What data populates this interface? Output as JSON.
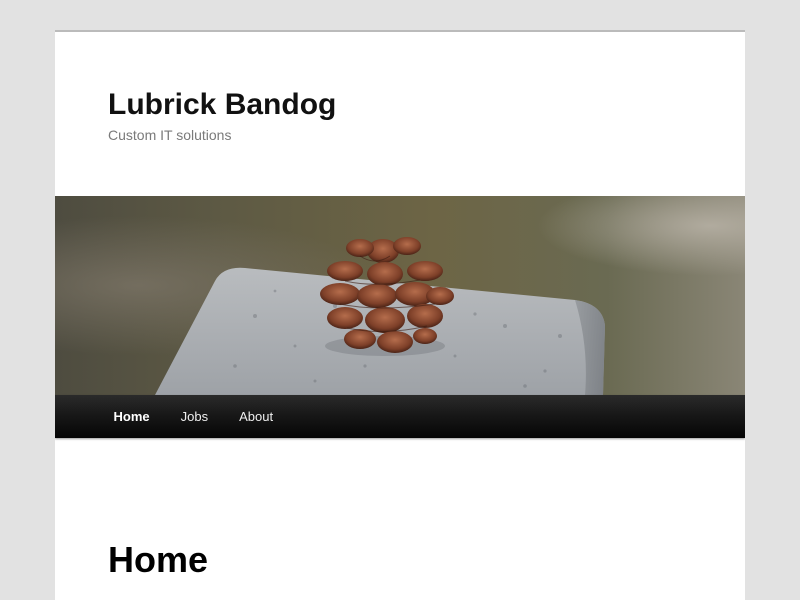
{
  "site": {
    "title": "Lubrick Bandog",
    "description": "Custom IT solutions"
  },
  "header_image": {
    "subject": "pinecone-on-granite",
    "colors": {
      "background": "#6b6446",
      "granite": "#a9acb0",
      "pinecone": "#8a4c34"
    }
  },
  "nav": {
    "items": [
      {
        "label": "Home",
        "current": true
      },
      {
        "label": "Jobs",
        "current": false
      },
      {
        "label": "About",
        "current": false
      }
    ]
  },
  "content": {
    "page_title": "Home"
  },
  "colors": {
    "page_background": "#e2e2e2",
    "content_background": "#ffffff",
    "nav_background": "#111111",
    "title_text": "#111111",
    "description_text": "#7a7a7a"
  }
}
